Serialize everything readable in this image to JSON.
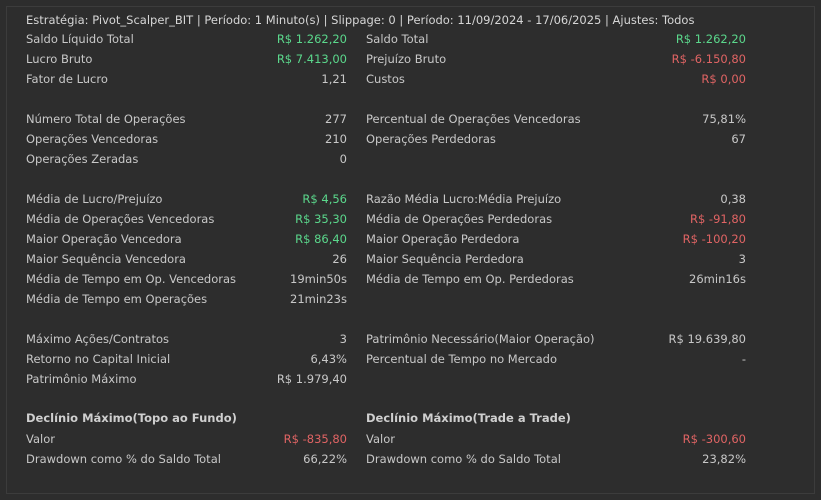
{
  "header": "Estratégia: Pivot_Scalper_BIT | Período: 1 Minuto(s) | Slippage: 0 | Período: 11/09/2024 - 17/06/2025 | Ajustes: Todos",
  "colors": {
    "background": "#2d2d2d",
    "text": "#c8c8c8",
    "positive": "#5bd88c",
    "negative": "#e06464"
  },
  "left": [
    {
      "label": "Saldo Líquido Total",
      "value": "R$ 1.262,20",
      "tone": "pos"
    },
    {
      "label": "Lucro Bruto",
      "value": "R$ 7.413,00",
      "tone": "pos"
    },
    {
      "label": "Fator de Lucro",
      "value": "1,21",
      "tone": ""
    },
    {
      "label": "Número Total de Operações",
      "value": "277",
      "tone": ""
    },
    {
      "label": "Operações Vencedoras",
      "value": "210",
      "tone": ""
    },
    {
      "label": "Operações Zeradas",
      "value": "0",
      "tone": ""
    },
    {
      "label": "Média de Lucro/Prejuízo",
      "value": "R$ 4,56",
      "tone": "pos"
    },
    {
      "label": "Média de Operações Vencedoras",
      "value": "R$ 35,30",
      "tone": "pos"
    },
    {
      "label": "Maior Operação Vencedora",
      "value": "R$ 86,40",
      "tone": "pos"
    },
    {
      "label": "Maior Sequência Vencedora",
      "value": "26",
      "tone": ""
    },
    {
      "label": "Média de Tempo em Op. Vencedoras",
      "value": "19min50s",
      "tone": ""
    },
    {
      "label": "Média de Tempo em Operações",
      "value": "21min23s",
      "tone": ""
    },
    {
      "label": "Máximo Ações/Contratos",
      "value": "3",
      "tone": ""
    },
    {
      "label": "Retorno no Capital Inicial",
      "value": "6,43%",
      "tone": ""
    },
    {
      "label": "Patrimônio Máximo",
      "value": "R$ 1.979,40",
      "tone": ""
    },
    {
      "label": "Valor",
      "value": "R$ -835,80",
      "tone": "neg"
    },
    {
      "label": "Drawdown como % do Saldo Total",
      "value": "66,22%",
      "tone": ""
    }
  ],
  "right": [
    {
      "label": "Saldo Total",
      "value": "R$ 1.262,20",
      "tone": "pos"
    },
    {
      "label": "Prejuízo Bruto",
      "value": "R$ -6.150,80",
      "tone": "neg"
    },
    {
      "label": "Custos",
      "value": "R$ 0,00",
      "tone": "neg"
    },
    {
      "label": "Percentual de Operações Vencedoras",
      "value": "75,81%",
      "tone": ""
    },
    {
      "label": "Operações Perdedoras",
      "value": "67",
      "tone": ""
    },
    {
      "label": "Razão Média Lucro:Média Prejuízo",
      "value": "0,38",
      "tone": ""
    },
    {
      "label": "Média de Operações Perdedoras",
      "value": "R$ -91,80",
      "tone": "neg"
    },
    {
      "label": "Maior Operação Perdedora",
      "value": "R$ -100,20",
      "tone": "neg"
    },
    {
      "label": "Maior Sequência Perdedora",
      "value": "3",
      "tone": ""
    },
    {
      "label": "Média de Tempo em Op. Perdedoras",
      "value": "26min16s",
      "tone": ""
    },
    {
      "label": "Patrimônio Necessário(Maior Operação)",
      "value": "R$ 19.639,80",
      "tone": ""
    },
    {
      "label": "Percentual de Tempo no Mercado",
      "value": "-",
      "tone": ""
    },
    {
      "label": "Valor",
      "value": "R$ -300,60",
      "tone": "neg"
    },
    {
      "label": "Drawdown como % do Saldo Total",
      "value": "23,82%",
      "tone": ""
    }
  ],
  "sections": {
    "left_title": "Declínio Máximo(Topo ao Fundo)",
    "right_title": "Declínio Máximo(Trade a Trade)"
  }
}
